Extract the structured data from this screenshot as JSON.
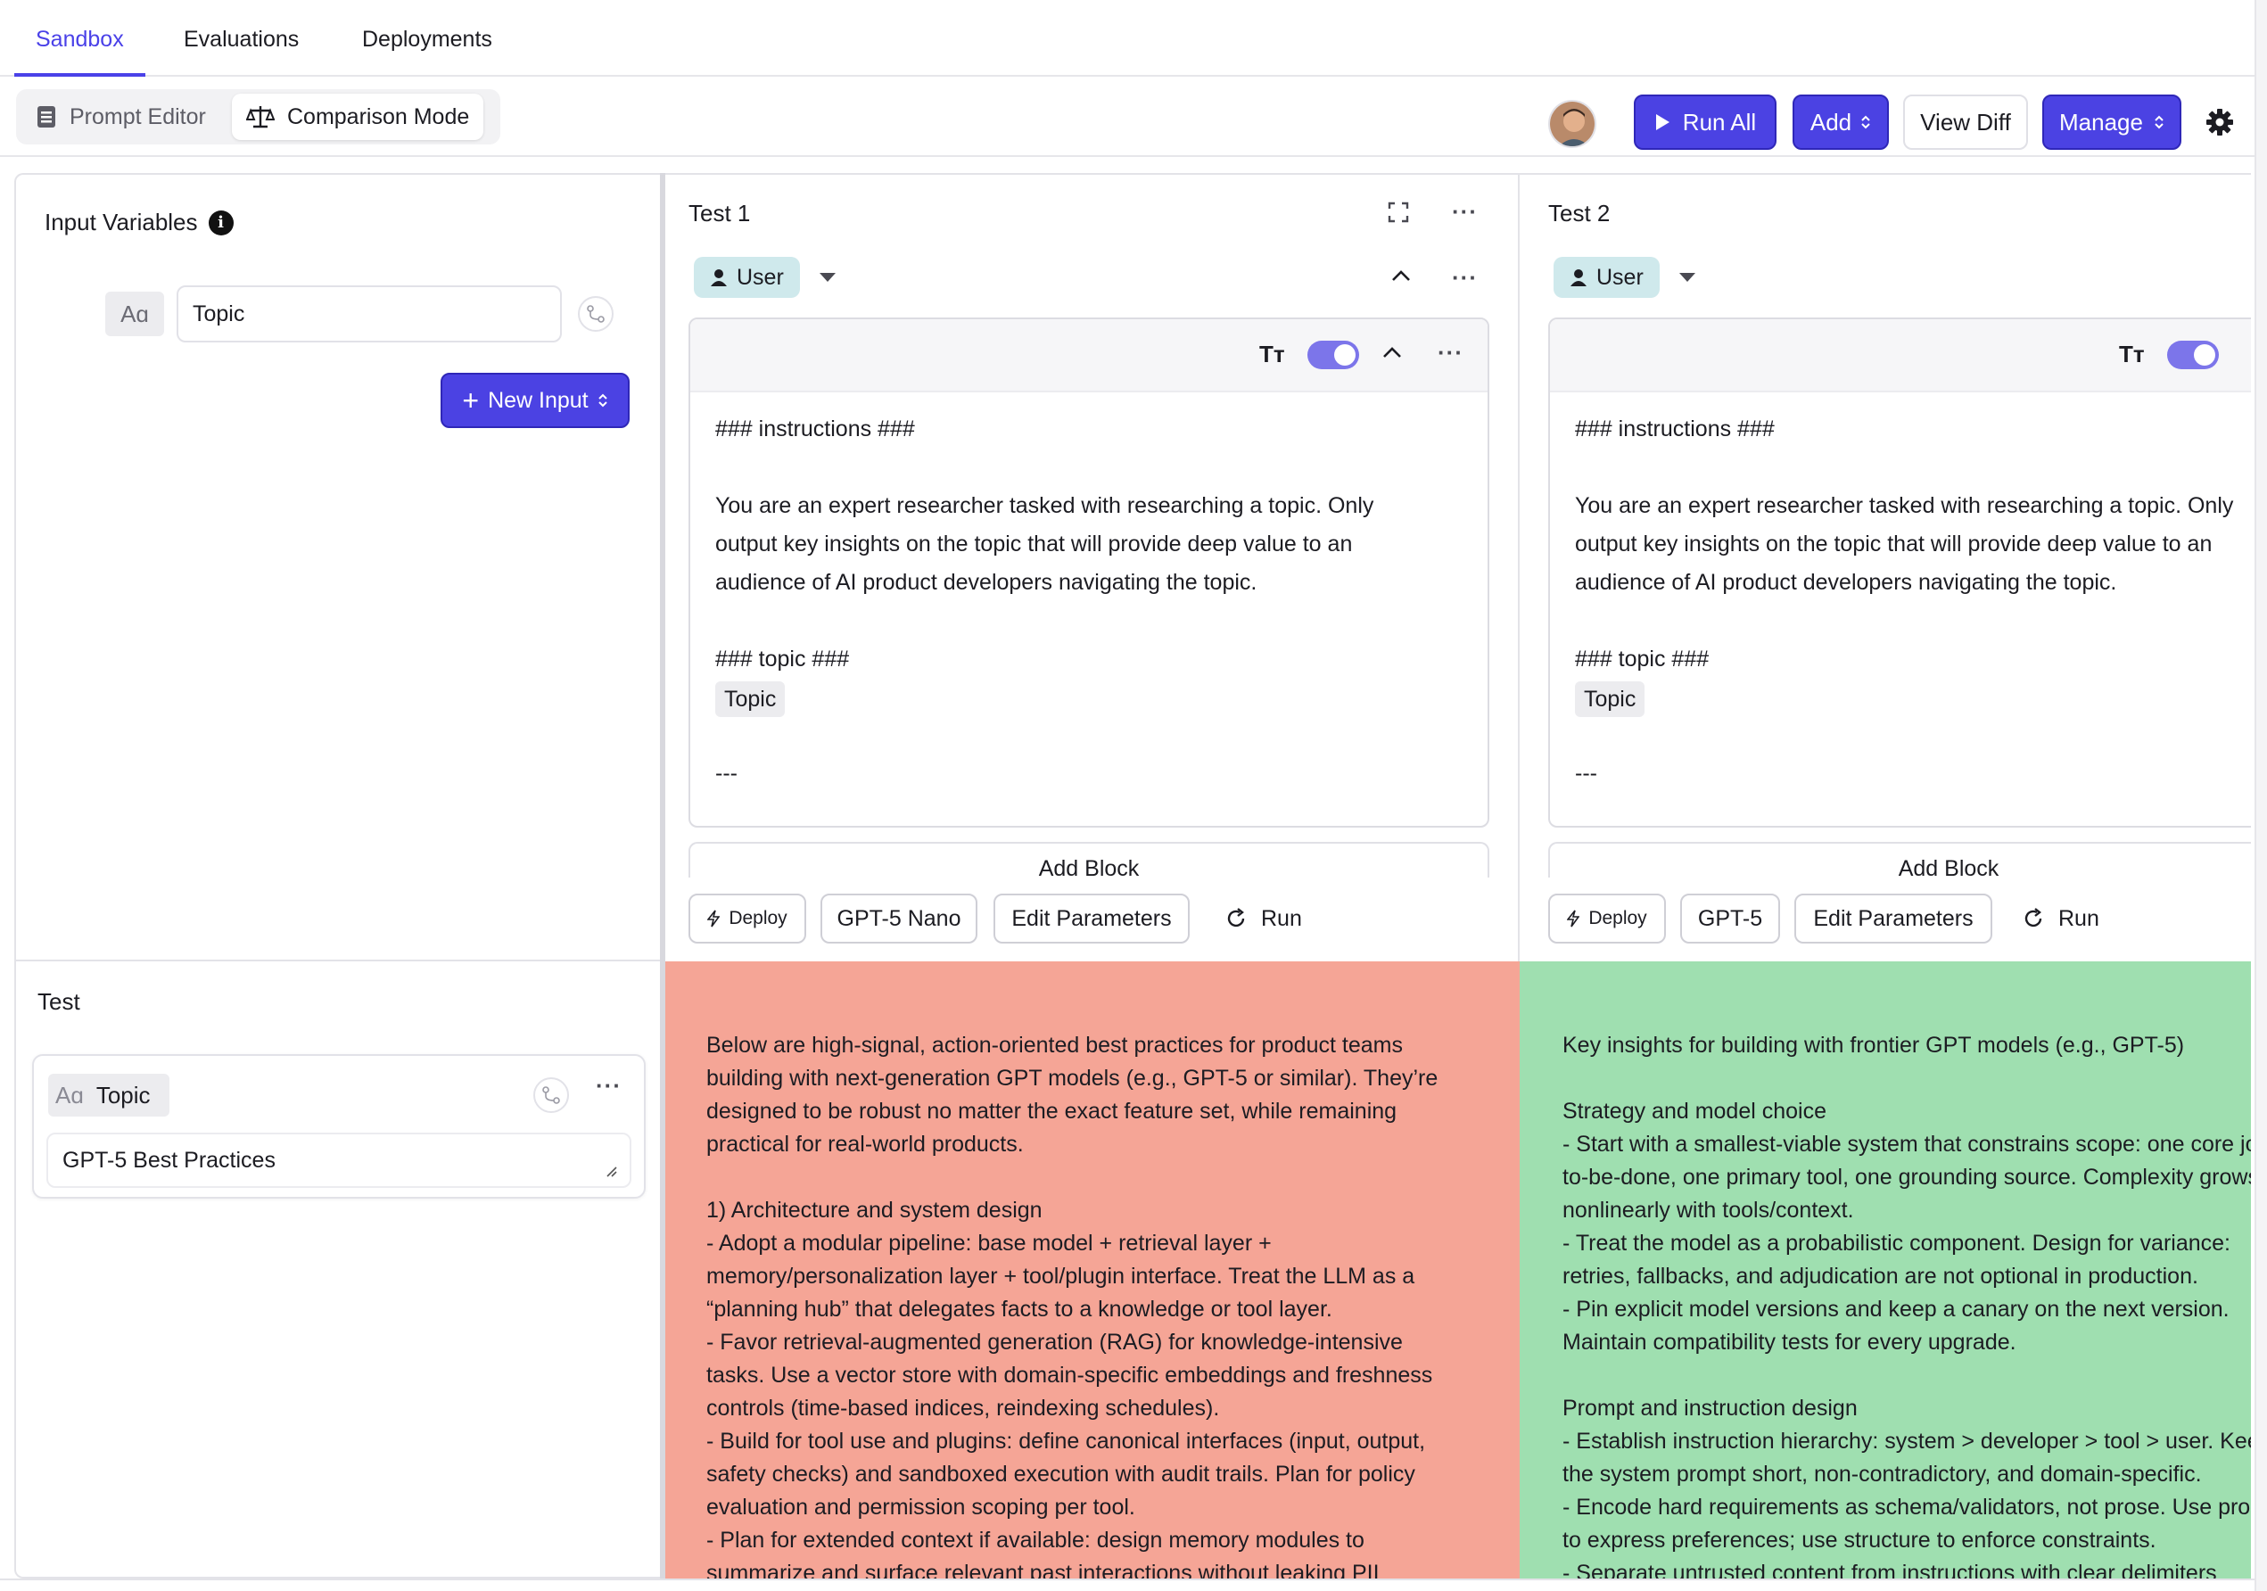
{
  "top_tabs": [
    {
      "label": "Sandbox",
      "active": true
    },
    {
      "label": "Evaluations",
      "active": false
    },
    {
      "label": "Deployments",
      "active": false
    }
  ],
  "mode_switch": {
    "prompt_editor": "Prompt Editor",
    "comparison_mode": "Comparison Mode",
    "active": "comparison_mode"
  },
  "toolbar": {
    "run_all": "Run All",
    "add": "Add",
    "view_diff": "View Diff",
    "manage": "Manage"
  },
  "input_variables": {
    "title": "Input Variables",
    "type_label": "Aɑ",
    "variable_name": "Topic",
    "new_input": "New Input"
  },
  "test_panel": {
    "title": "Test",
    "type_label": "Aɑ",
    "variable_name": "Topic",
    "value": "GPT-5 Best Practices"
  },
  "tests": [
    {
      "title": "Test 1",
      "role": "User",
      "prompt_heading": "### instructions ###",
      "prompt_body": "You are an expert researcher tasked with researching a topic. Only\noutput key insights on the topic that will provide deep value to an\naudience of AI product developers navigating the topic.",
      "topic_heading": "### topic ###",
      "topic_var": "Topic",
      "separator": "---",
      "add_block": "Add Block",
      "deploy": "Deploy",
      "model": "GPT-5 Nano",
      "edit_params": "Edit Parameters",
      "run": "Run",
      "output_color": "#f5a596",
      "output": "Below are high-signal, action-oriented best practices for product teams\nbuilding with next-generation GPT models (e.g., GPT-5 or similar). They’re\ndesigned to be robust no matter the exact feature set, while remaining\npractical for real-world products.\n\n1) Architecture and system design\n- Adopt a modular pipeline: base model + retrieval layer +\nmemory/personalization layer + tool/plugin interface. Treat the LLM as a\n“planning hub” that delegates facts to a knowledge or tool layer.\n- Favor retrieval-augmented generation (RAG) for knowledge-intensive\ntasks. Use a vector store with domain-specific embeddings and freshness\ncontrols (time-based indices, reindexing schedules).\n- Build for tool use and plugins: define canonical interfaces (input, output,\nsafety checks) and sandboxed execution with audit trails. Plan for policy\nevaluation and permission scoping per tool.\n- Plan for extended context if available: design memory modules to\nsummarize and surface relevant past interactions without leaking PII"
    },
    {
      "title": "Test 2",
      "role": "User",
      "prompt_heading": "### instructions ###",
      "prompt_body": "You are an expert researcher tasked with researching a topic. Only\noutput key insights on the topic that will provide deep value to an\naudience of AI product developers navigating the topic.",
      "topic_heading": "### topic ###",
      "topic_var": "Topic",
      "separator": "---",
      "add_block": "Add Block",
      "deploy": "Deploy",
      "model": "GPT-5",
      "edit_params": "Edit Parameters",
      "run": "Run",
      "output_color": "#9fdfb0",
      "output": "Key insights for building with frontier GPT models (e.g., GPT-5)\n\nStrategy and model choice\n- Start with a smallest-viable system that constrains scope: one core job-\nto-be-done, one primary tool, one grounding source. Complexity grows\nnonlinearly with tools/context.\n- Treat the model as a probabilistic component. Design for variance:\nretries, fallbacks, and adjudication are not optional in production.\n- Pin explicit model versions and keep a canary on the next version.\nMaintain compatibility tests for every upgrade.\n\nPrompt and instruction design\n- Establish instruction hierarchy: system > developer > tool > user. Keep\nthe system prompt short, non-contradictory, and domain-specific.\n- Encode hard requirements as schema/validators, not prose. Use prose\nto express preferences; use structure to enforce constraints.\n- Separate untrusted content from instructions with clear delimiters"
    }
  ]
}
